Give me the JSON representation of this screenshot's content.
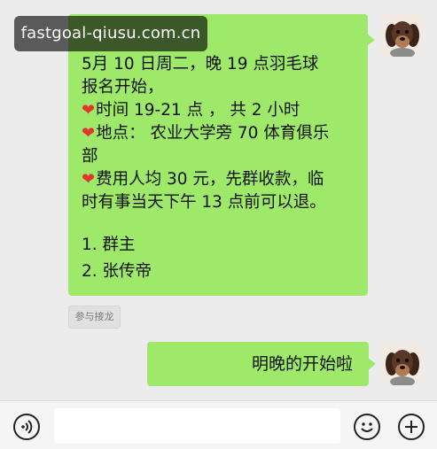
{
  "watermark": {
    "text": "fastgoal-qiusu.com.cn"
  },
  "messages": [
    {
      "sender": "self",
      "avatar_icon": "dog-avatar-icon",
      "lines": [
        {
          "heart": false,
          "text": "5月 10 日周二，晚 19 点羽毛球"
        },
        {
          "heart": false,
          "text": "报名开始，"
        },
        {
          "heart": true,
          "text": "时间 19-21 点 ， 共 2 小时"
        },
        {
          "heart": true,
          "text": "地点： 农业大学旁 70 体育俱乐"
        },
        {
          "heart": false,
          "text": "部"
        },
        {
          "heart": true,
          "text": "费用人均 30 元，先群收款，临"
        },
        {
          "heart": false,
          "text": "时有事当天下午 13 点前可以退。"
        }
      ],
      "list": [
        "1. 群主",
        "2. 张传帝"
      ]
    },
    {
      "sender": "self",
      "avatar_icon": "dog-avatar-icon",
      "text": "明晚的开始啦"
    }
  ],
  "join_chip": {
    "label": "参与接龙"
  },
  "input_bar": {
    "voice_icon": "voice-icon",
    "emoji_icon": "emoji-icon",
    "add_icon": "plus-icon",
    "value": ""
  },
  "colors": {
    "bubble": "#9ee86a",
    "background": "#ececec",
    "heart": "#e0362e"
  }
}
